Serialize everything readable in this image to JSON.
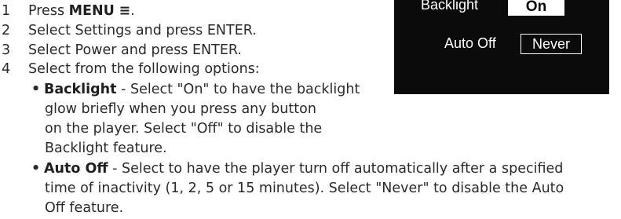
{
  "steps": [
    {
      "num": "1",
      "text_prefix": "Press ",
      "menu_label": "MENU",
      "menu_icon": "≡",
      "text_suffix": "."
    },
    {
      "num": "2",
      "text": "Select Settings and press ENTER."
    },
    {
      "num": "3",
      "text": "Select Power and press ENTER."
    },
    {
      "num": "4",
      "text": "Select from the following options:"
    }
  ],
  "options": {
    "bullet": "•",
    "backlight": {
      "title": "Backlight",
      "lines": [
        " - Select \"On\" to have the backlight",
        "glow briefly when you press any button",
        "on the player. Select \"Off\" to disable the",
        "Backlight feature."
      ]
    },
    "auto_off": {
      "title": "Auto Off",
      "lines": [
        " - Select to have the player turn off automatically after a specified",
        "time of inactivity (1, 2, 5 or 15 minutes). Select \"Never\" to disable the Auto",
        "Off feature."
      ]
    }
  },
  "screen": {
    "backlight_label": "Backlight",
    "backlight_value": "On",
    "auto_off_label": "Auto Off",
    "auto_off_value": "Never",
    "colors": {
      "background": "#0b0b0b",
      "text": "#ffffff",
      "highlight_bg": "#ffffff",
      "highlight_text": "#000000"
    }
  }
}
